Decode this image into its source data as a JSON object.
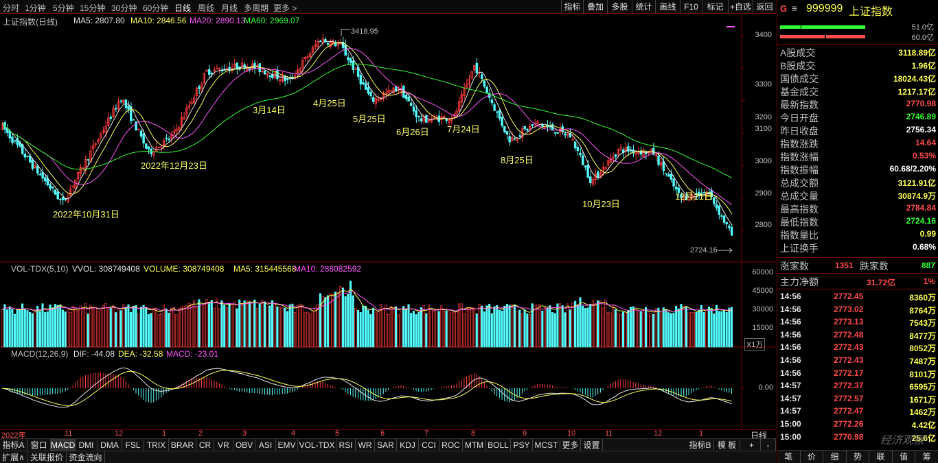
{
  "topbar": {
    "periods": [
      "分时",
      "1分钟",
      "5分钟",
      "15分钟",
      "30分钟",
      "60分钟",
      "日线",
      "周线",
      "月线",
      "多周期",
      "更多 >"
    ],
    "active_period": "日线",
    "tools": [
      "指标",
      "叠加",
      "多股",
      "统计",
      "画线",
      "F10",
      "标记",
      "+自选",
      "返回"
    ]
  },
  "main": {
    "title": "上证指数(日线)",
    "ma5": "MA5: 2807.80",
    "ma10": "MA10: 2846.56",
    "ma20": "MA20: 2890.13",
    "ma60": "MA60: 2969.07",
    "high_label": "3418.95",
    "low_label": "2724.16",
    "yticks": [
      "3400",
      "3300",
      "3200",
      "3100",
      "3000",
      "2900",
      "2800"
    ],
    "annotations": [
      "2022年10月31日",
      "2022年12月23日",
      "3月14日",
      "4月25日",
      "5月25日",
      "6月26日",
      "7月24日",
      "8月25日",
      "10月23日",
      "12月21日"
    ]
  },
  "vol": {
    "title": "VOL-TDX(5,10)",
    "vvol": "VVOL: 308749408",
    "volume": "VOLUME: 308749408",
    "ma5": "MA5: 315445568",
    "ma10": "MA10: 288082592",
    "yticks": [
      "60000",
      "45000",
      "30000",
      "15000"
    ],
    "unit": "X1万"
  },
  "macd": {
    "title": "MACD(12,26,9)",
    "dif": "DIF: -44.08",
    "dea": "DEA: -32.58",
    "macd": "MACD: -23.01",
    "ytick": "0.00"
  },
  "xaxis": {
    "labels": [
      "2022年",
      "11",
      "12",
      "1",
      "2",
      "3",
      "4",
      "5",
      "6",
      "7",
      "8",
      "9",
      "10",
      "11",
      "12",
      "1"
    ],
    "right": "日线"
  },
  "tabs": [
    "指标A",
    "窗口",
    "MACD",
    "DMI",
    "DMA",
    "FSL",
    "TRIX",
    "BRAR",
    "CR",
    "VR",
    "OBV",
    "ASI",
    "EMV",
    "VOL-TDX",
    "RSI",
    "WR",
    "SAR",
    "KDJ",
    "CCI",
    "ROC",
    "MTM",
    "BOLL",
    "PSY",
    "MCST",
    "更多",
    "设置"
  ],
  "active_tab": "MACD",
  "tabs_right": [
    "指标B",
    "模 板",
    "+",
    "-"
  ],
  "tabs2": [
    "扩展∧",
    "关联报价",
    "资金流向"
  ],
  "right_panel": {
    "code_badge": "G",
    "menu_icon": "≡",
    "code": "999999",
    "name": "上证指数",
    "ratio1": "51.0亿",
    "ratio2": "60.0亿",
    "rows": [
      {
        "k": "A股成交",
        "v": "3118.89亿",
        "c": "#ffff55"
      },
      {
        "k": "B股成交",
        "v": "1.96亿",
        "c": "#ffff55"
      },
      {
        "k": "国债成交",
        "v": "18024.43亿",
        "c": "#ffff55"
      },
      {
        "k": "基金成交",
        "v": "1217.17亿",
        "c": "#ffff55"
      },
      {
        "k": "最新指数",
        "v": "2770.98",
        "c": "#ff4a4a"
      },
      {
        "k": "今日开盘",
        "v": "2746.89",
        "c": "#33ff33"
      },
      {
        "k": "昨日收盘",
        "v": "2756.34",
        "c": "#ffffff"
      },
      {
        "k": "指数涨跌",
        "v": "14.64",
        "c": "#ff4a4a"
      },
      {
        "k": "指数涨幅",
        "v": "0.53%",
        "c": "#ff4a4a"
      },
      {
        "k": "指数振幅",
        "v": "60.68/2.20%",
        "c": "#ffffff"
      },
      {
        "k": "总成交额",
        "v": "3121.91亿",
        "c": "#ffff55"
      },
      {
        "k": "总成交量",
        "v": "30874.9万",
        "c": "#ffff55"
      },
      {
        "k": "最高指数",
        "v": "2784.84",
        "c": "#ff4a4a"
      },
      {
        "k": "最低指数",
        "v": "2724.16",
        "c": "#33ff33"
      },
      {
        "k": "指数量比",
        "v": "0.99",
        "c": "#ffff55"
      },
      {
        "k": "上证换手",
        "v": "0.68%",
        "c": "#ffffff"
      }
    ],
    "up_label": "涨家数",
    "up_value": "1351",
    "down_label": "跌家数",
    "down_value": "887",
    "flow_label": "主力净额",
    "flow_value": "31.72亿",
    "flow_pct": "1%",
    "ticks": [
      {
        "t": "14:56",
        "p": "2772.45",
        "v": "8360万"
      },
      {
        "t": "14:56",
        "p": "2773.02",
        "v": "8764万"
      },
      {
        "t": "14:56",
        "p": "2773.13",
        "v": "7543万"
      },
      {
        "t": "14:56",
        "p": "2772.48",
        "v": "8477万"
      },
      {
        "t": "14:56",
        "p": "2772.43",
        "v": "8052万"
      },
      {
        "t": "14:56",
        "p": "2772.43",
        "v": "7487万"
      },
      {
        "t": "14:56",
        "p": "2772.17",
        "v": "8101万"
      },
      {
        "t": "14:57",
        "p": "2772.37",
        "v": "6595万"
      },
      {
        "t": "14:57",
        "p": "2772.57",
        "v": "1671万"
      },
      {
        "t": "14:57",
        "p": "2772.47",
        "v": "1462万"
      },
      {
        "t": "15:00",
        "p": "2772.26",
        "v": "4.42亿"
      },
      {
        "t": "15:00",
        "p": "2770.98",
        "v": "25.6亿"
      }
    ],
    "bottom_tabs": [
      "笔",
      "价",
      "细",
      "势",
      "联",
      "值",
      "筹"
    ],
    "watermark": "经济观察"
  }
}
